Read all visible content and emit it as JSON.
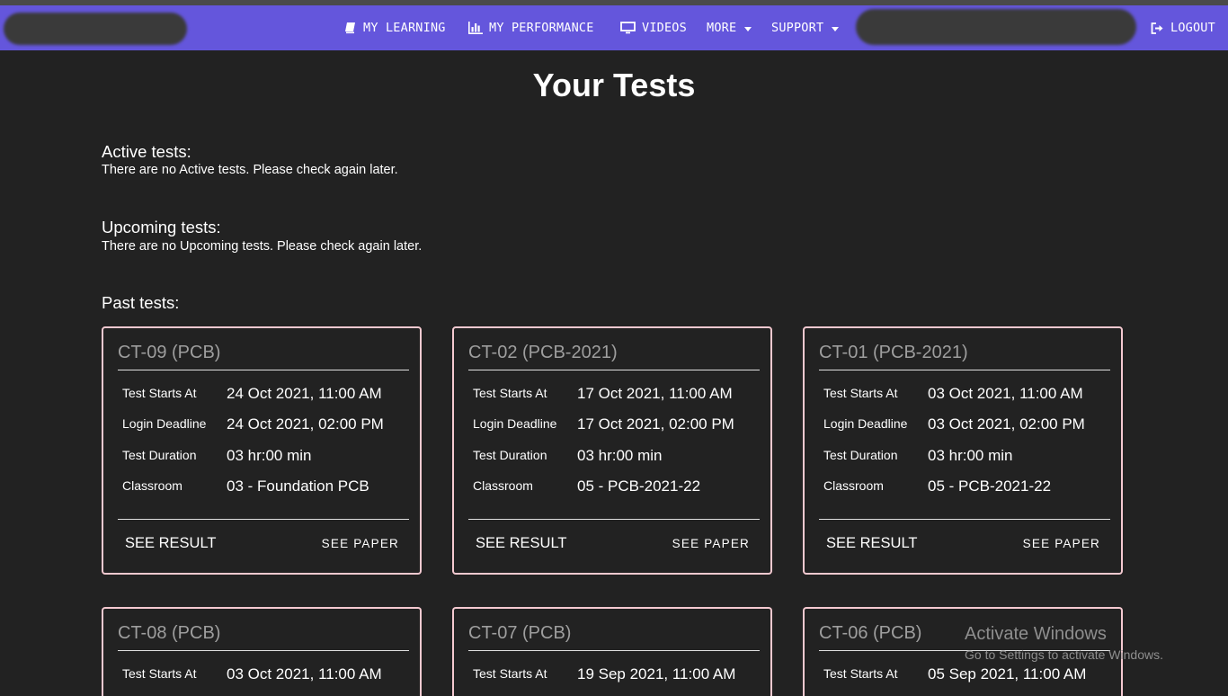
{
  "navbar": {
    "items": [
      {
        "label": "MY LEARNING",
        "icon": "book-icon"
      },
      {
        "label": "MY PERFORMANCE",
        "icon": "bar-chart-icon"
      },
      {
        "label": "VIDEOS",
        "icon": "monitor-icon"
      },
      {
        "label": "MORE",
        "icon": "chevron-down-icon"
      },
      {
        "label": "SUPPORT",
        "icon": "chevron-down-icon"
      },
      {
        "label": "LOGOUT",
        "icon": "logout-icon"
      }
    ],
    "accent_color": "#6456dc"
  },
  "page": {
    "title": "Your Tests",
    "background_color": "#222222"
  },
  "active": {
    "heading": "Active tests:",
    "message": "There are no Active tests. Please check again later."
  },
  "upcoming": {
    "heading": "Upcoming tests:",
    "message": "There are no Upcoming tests. Please check again later."
  },
  "past": {
    "heading": "Past tests:",
    "field_labels": {
      "starts": "Test Starts At",
      "deadline": "Login Deadline",
      "duration": "Test Duration",
      "classroom": "Classroom"
    },
    "action_labels": {
      "result": "SEE RESULT",
      "paper": "SEE PAPER"
    },
    "card_border_color": "#f4c9d0",
    "cards": [
      {
        "title": "CT-09 (PCB)",
        "starts": "24 Oct 2021, 11:00 AM",
        "deadline": "24 Oct 2021, 02:00 PM",
        "duration": "03 hr:00 min",
        "classroom": "03 - Foundation PCB"
      },
      {
        "title": "CT-02 (PCB-2021)",
        "starts": "17 Oct 2021, 11:00 AM",
        "deadline": "17 Oct 2021, 02:00 PM",
        "duration": "03 hr:00 min",
        "classroom": "05 - PCB-2021-22"
      },
      {
        "title": "CT-01 (PCB-2021)",
        "starts": "03 Oct 2021, 11:00 AM",
        "deadline": "03 Oct 2021, 02:00 PM",
        "duration": "03 hr:00 min",
        "classroom": "05 - PCB-2021-22"
      },
      {
        "title": "CT-08 (PCB)",
        "starts": "03 Oct 2021, 11:00 AM"
      },
      {
        "title": "CT-07 (PCB)",
        "starts": "19 Sep 2021, 11:00 AM"
      },
      {
        "title": "CT-06 (PCB)",
        "starts": "05 Sep 2021, 11:00 AM"
      }
    ]
  },
  "watermark": {
    "title": "Activate Windows",
    "subtitle": "Go to Settings to activate Windows."
  }
}
